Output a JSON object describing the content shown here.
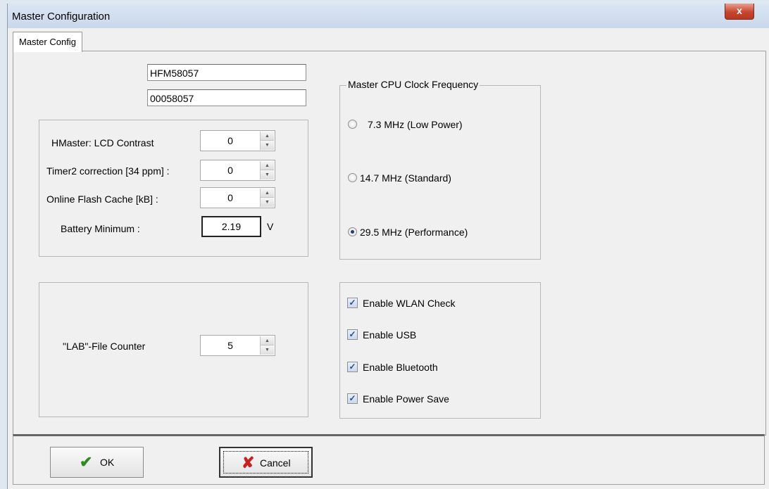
{
  "window": {
    "title": "Master Configuration",
    "close_glyph": "x"
  },
  "tabs": [
    {
      "label": "Master Config"
    }
  ],
  "identity": {
    "name_value": "HFM58057",
    "serial_value": "00058057"
  },
  "settings_group": {
    "lcd_contrast": {
      "label": "HMaster:  LCD Contrast",
      "value": "0"
    },
    "timer2_correction": {
      "label": "Timer2 correction [34 ppm] :",
      "value": "0"
    },
    "flash_cache": {
      "label": "Online Flash Cache [kB] :",
      "value": "0"
    },
    "battery_minimum": {
      "label": "Battery Minimum :",
      "value": "2.19",
      "unit": "V"
    }
  },
  "lab_group": {
    "file_counter": {
      "label": "\"LAB\"-File Counter",
      "value": "5"
    }
  },
  "clock_group": {
    "legend": "Master CPU Clock Frequency",
    "options": [
      {
        "label": "7.3 MHz (Low Power)",
        "checked": false
      },
      {
        "label": "14.7 MHz (Standard)",
        "checked": false
      },
      {
        "label": "29.5 MHz (Performance)",
        "checked": true
      }
    ]
  },
  "options_group": {
    "checkboxes": [
      {
        "label": "Enable WLAN Check",
        "checked": true
      },
      {
        "label": "Enable USB",
        "checked": true
      },
      {
        "label": "Enable Bluetooth",
        "checked": true
      },
      {
        "label": "Enable Power Save",
        "checked": true
      }
    ]
  },
  "footer": {
    "ok_label": "OK",
    "cancel_label": "Cancel",
    "ok_icon": "checkmark-icon",
    "cancel_icon": "x-mark-icon"
  },
  "colors": {
    "ok_icon": "#2e8b1e",
    "cancel_icon": "#c62020",
    "radio_dot": "#1f3f72"
  }
}
